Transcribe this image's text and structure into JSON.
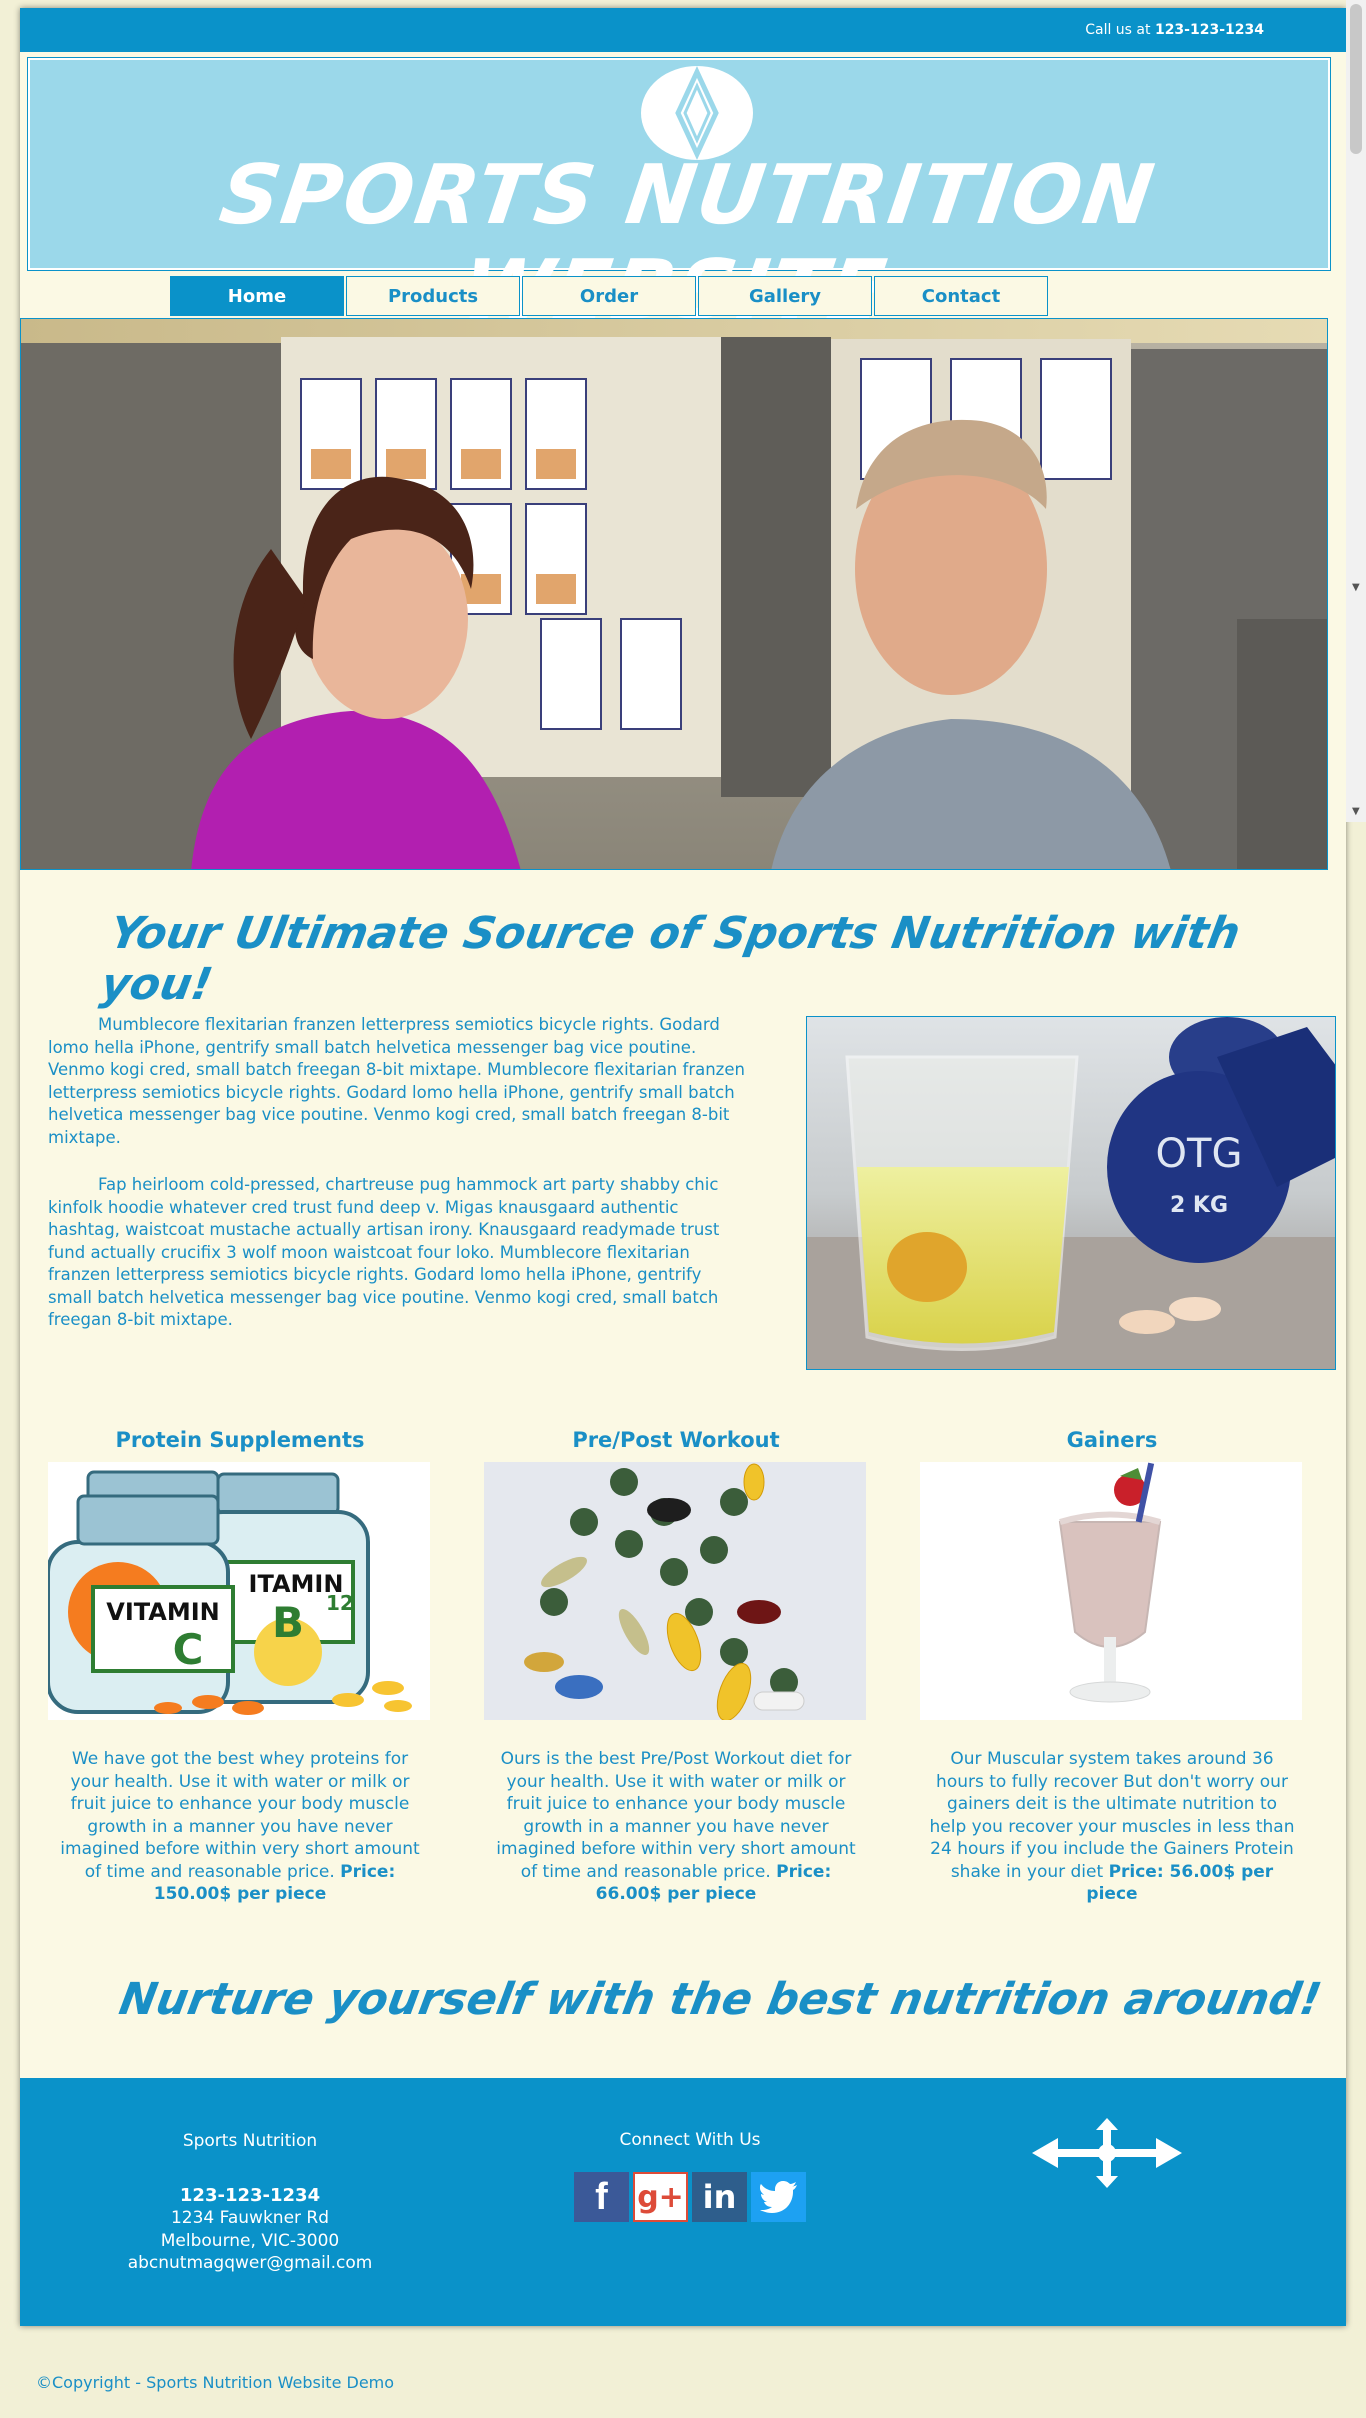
{
  "header": {
    "call_prefix": "Call us at",
    "call_number": "123-123-1234",
    "site_title": "SPORTS NUTRITION WEBSITE"
  },
  "nav": {
    "items": [
      {
        "label": "Home",
        "active": true
      },
      {
        "label": "Products",
        "active": false
      },
      {
        "label": "Order",
        "active": false
      },
      {
        "label": "Gallery",
        "active": false
      },
      {
        "label": "Contact",
        "active": false
      }
    ]
  },
  "main": {
    "headline": "Your Ultimate Source of Sports Nutrition with you!",
    "paragraph1": "Mumblecore flexitarian franzen letterpress semiotics bicycle rights. Godard lomo hella iPhone, gentrify small batch helvetica messenger bag vice poutine. Venmo kogi cred, small batch freegan 8-bit mixtape. Mumblecore flexitarian franzen letterpress semiotics bicycle rights. Godard lomo hella iPhone, gentrify small batch helvetica messenger bag vice poutine. Venmo kogi cred, small batch freegan 8-bit mixtape.",
    "paragraph2": "Fap heirloom cold-pressed, chartreuse pug hammock art party shabby chic kinfolk hoodie whatever cred trust fund deep v. Migas knausgaard authentic hashtag, waistcoat mustache actually artisan irony. Knausgaard readymade trust fund actually crucifix 3 wolf moon waistcoat four loko. Mumblecore flexitarian franzen letterpress semiotics bicycle rights. Godard lomo hella iPhone, gentrify small batch helvetica messenger bag vice poutine. Venmo kogi cred, small batch freegan 8-bit mixtape.",
    "products": [
      {
        "title": "Protein Supplements",
        "description": "We have got the best whey proteins for your health. Use it with water or milk or fruit juice to enhance your body muscle growth in a manner you have never imagined before within very short amount of time and reasonable price.",
        "price": "Price: 150.00$ per piece"
      },
      {
        "title": "Pre/Post Workout",
        "description": "Ours is the best Pre/Post Workout diet for your health. Use it with water or milk or fruit juice to enhance your body muscle growth in a manner you have never imagined before within very short amount of time and reasonable price.",
        "price": "Price: 66.00$ per piece"
      },
      {
        "title": "Gainers",
        "description": "Our Muscular system takes around 36 hours to fully recover But don't worry our gainers deit is the ultimate nutrition to help you recover your muscles in less than 24 hours if you include the Gainers Protein shake in your diet",
        "price": "Price: 56.00$ per piece"
      }
    ],
    "image_text": {
      "vitamin_c": "VITAMIN C",
      "vitamin_b12": "VITAMIN B12",
      "dumbbell": "2 KG",
      "dumbbell_brand": "OTG"
    },
    "closing": "Nurture yourself with the best nutrition around!"
  },
  "footer": {
    "col1_title": "Sports Nutrition",
    "phone": "123-123-1234",
    "address1": "1234 Fauwkner Rd",
    "address2": "Melbourne, VIC-3000",
    "email": "abcnutmagqwer@gmail.com",
    "col2_title": "Connect With Us",
    "social": [
      "facebook-icon",
      "google-plus-icon",
      "linkedin-icon",
      "twitter-icon"
    ]
  },
  "copyright": "©Copyright - Sports Nutrition Website Demo",
  "colors": {
    "accent": "#0a92c9",
    "banner": "#9bd8ea",
    "page_bg": "#fbf9e4",
    "outer_bg": "#f2f0d6"
  }
}
